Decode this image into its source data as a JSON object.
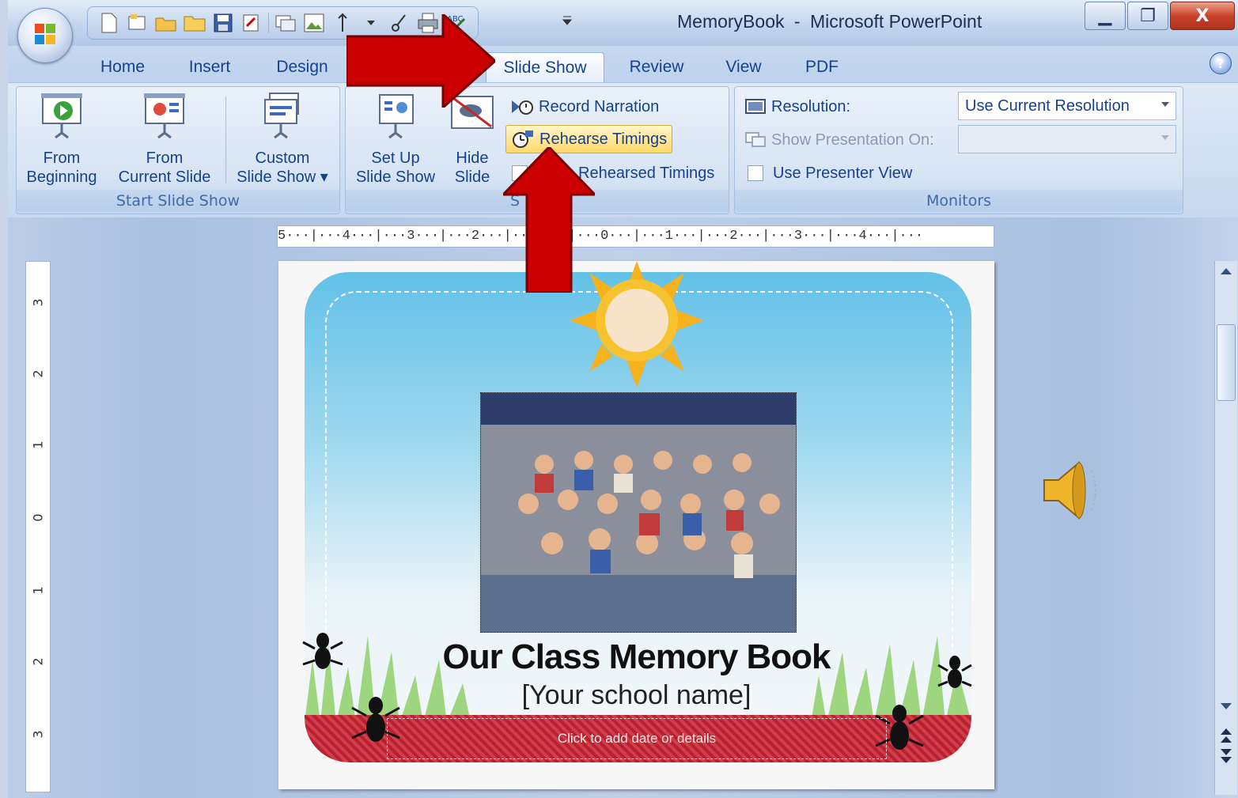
{
  "window": {
    "title_doc": "MemoryBook",
    "title_sep": "-",
    "title_app": "Microsoft PowerPoint",
    "minimize_glyph": "▁",
    "restore_glyph": "❐",
    "close_glyph": "X"
  },
  "qat_icons": [
    "new-icon",
    "new-slide-icon",
    "open-icon",
    "folder-icon",
    "save-icon",
    "properties-icon",
    "slide-layout-icon",
    "picture-icon",
    "sort-icon",
    "dropdown-icon",
    "cut-icon",
    "print-icon",
    "spelling-icon",
    "customize-qat-icon"
  ],
  "tabs": {
    "home": "Home",
    "insert": "Insert",
    "design": "Design",
    "slideshow": "Slide Show",
    "review": "Review",
    "view": "View",
    "pdf": "PDF",
    "active": "Slide Show"
  },
  "help": "?",
  "ribbon": {
    "start": {
      "label": "Start Slide Show",
      "from_beginning": [
        "From",
        "Beginning"
      ],
      "from_current": [
        "From",
        "Current Slide"
      ],
      "custom": [
        "Custom",
        "Slide Show ▾"
      ]
    },
    "setup": {
      "label": "S",
      "setup_show": [
        "Set Up",
        "Slide Show"
      ],
      "hide_slide": [
        "Hide",
        "Slide"
      ],
      "record_narration": "Record Narration",
      "rehearse_timings": "Rehearse Timings",
      "use_rehearsed": "Rehearsed Timings"
    },
    "monitors": {
      "label": "Monitors",
      "resolution_label": "Resolution:",
      "resolution_value": "Use Current Resolution",
      "show_on_label": "Show Presentation On:",
      "show_on_value": "",
      "presenter_view": "Use Presenter View"
    }
  },
  "ruler": {
    "horizontal": "5···|···4···|···3···|···2···|···1···|···0···|···1···|···2···|···3···|···4···|···",
    "vertical": [
      "3",
      "2",
      "1",
      "0",
      "1",
      "2",
      "3"
    ]
  },
  "slide": {
    "title": "Our Class Memory Book",
    "subtitle": "[Your school name]",
    "details_placeholder": "Click to add date or details"
  },
  "colors": {
    "ribbon_text": "#15428b",
    "highlight": "#ffd86a",
    "annotation_arrow": "#cc0000",
    "sky_top": "#63c1e8",
    "band_red": "#b8212f"
  }
}
